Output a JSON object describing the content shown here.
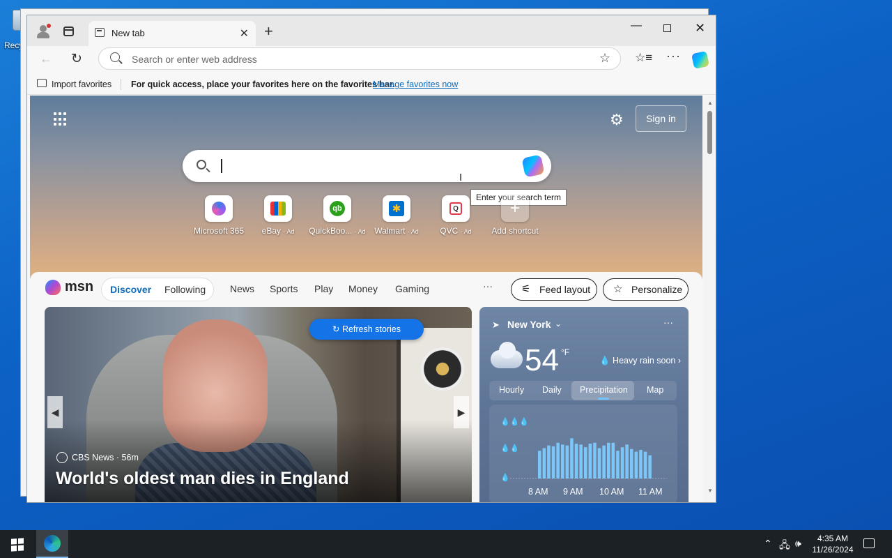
{
  "desktop": {
    "recycle_label": "Recy"
  },
  "browser": {
    "tab": {
      "title": "New tab"
    },
    "address": {
      "placeholder": "Search or enter web address"
    },
    "favorites_bar": {
      "import_label": "Import favorites",
      "message": "For quick access, place your favorites here on the favorites bar.",
      "manage_link": "Manage favorites now"
    }
  },
  "newtab": {
    "signin_label": "Sign in",
    "tooltip": "Enter your search term",
    "shortcuts": [
      {
        "label": "Microsoft 365",
        "ad": ""
      },
      {
        "label": "eBay",
        "ad": "· Ad"
      },
      {
        "label": "QuickBoo...",
        "ad": "· Ad"
      },
      {
        "label": "Walmart",
        "ad": "· Ad"
      },
      {
        "label": "QVC",
        "ad": "· Ad"
      },
      {
        "label": "Add shortcut",
        "ad": ""
      }
    ],
    "qb_glyph": "qb",
    "qvc_glyph": "Q"
  },
  "feed": {
    "brand": "msn",
    "pills": [
      "Discover",
      "Following"
    ],
    "nav": [
      "News",
      "Sports",
      "Play",
      "Money",
      "Gaming"
    ],
    "more": "···",
    "feed_layout": "Feed layout",
    "personalize": "Personalize",
    "refresh": "Refresh stories",
    "hero": {
      "source": "CBS News · 56m",
      "headline": "World's oldest man dies in England"
    },
    "weather": {
      "location": "New York",
      "temp": "54",
      "unit": "°F",
      "condition": "Heavy rain soon",
      "tabs": [
        "Hourly",
        "Daily",
        "Precipitation",
        "Map"
      ],
      "active_tab": "Precipitation",
      "times": [
        "8 AM",
        "9 AM",
        "10 AM",
        "11 AM"
      ],
      "precip_bars": [
        0.62,
        0.68,
        0.74,
        0.72,
        0.8,
        0.76,
        0.74,
        0.9,
        0.78,
        0.76,
        0.7,
        0.78,
        0.8,
        0.68,
        0.74,
        0.8,
        0.8,
        0.62,
        0.7,
        0.76,
        0.66,
        0.6,
        0.64,
        0.6,
        0.52
      ]
    }
  },
  "taskbar": {
    "time": "4:35 AM",
    "date": "11/26/2024"
  }
}
